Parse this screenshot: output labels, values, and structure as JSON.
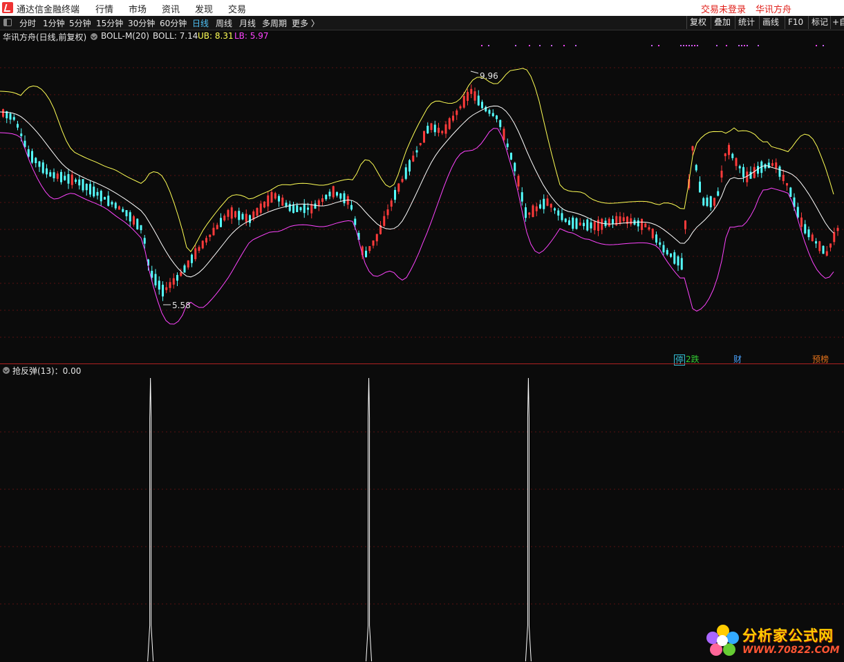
{
  "menubar": {
    "app_title": "通达信金融终端",
    "items": [
      "行情",
      "市场",
      "资讯",
      "发现",
      "交易"
    ],
    "login_status": "交易未登录",
    "brand": "华讯方舟"
  },
  "toolbar": {
    "periods": [
      "分时",
      "1分钟",
      "5分钟",
      "15分钟",
      "30分钟",
      "60分钟",
      "日线",
      "周线",
      "月线",
      "多周期",
      "更多 〉"
    ],
    "active_period": "日线",
    "right_buttons": [
      "复权",
      "叠加",
      "统计",
      "画线",
      "F10",
      "标记",
      "+自"
    ]
  },
  "main_panel": {
    "stock_name": "华讯方舟",
    "mode": "(日线,前复权)",
    "indicator": "BOLL-M(20)",
    "boll_label": "BOLL: 7.14",
    "ub_label": "UB: 8.31",
    "lb_label": "LB: 5.97",
    "high_marker": "9.96",
    "low_marker": "5.58",
    "badges": [
      {
        "text": "停",
        "color": "#35c0d8"
      },
      {
        "text": "2跌",
        "color": "#33cc33"
      },
      {
        "text": "财",
        "color": "#4aa3ff"
      },
      {
        "text": "预榜",
        "color": "#e0701a"
      }
    ]
  },
  "sub_panel": {
    "indicator_label": "抢反弹(13)：0.00",
    "signals": [
      {
        "bar_index": 53
      },
      {
        "bar_index": 131
      },
      {
        "bar_index": 188
      }
    ]
  },
  "colors": {
    "up_candle": "#ff3b3b",
    "down_candle": "#54ffff",
    "mid_band": "#ffffff",
    "upper_band": "#ffff55",
    "lower_band": "#ff44ff"
  },
  "watermark": {
    "text": "分析家公式网",
    "url": "WWW.70822.COM"
  }
}
